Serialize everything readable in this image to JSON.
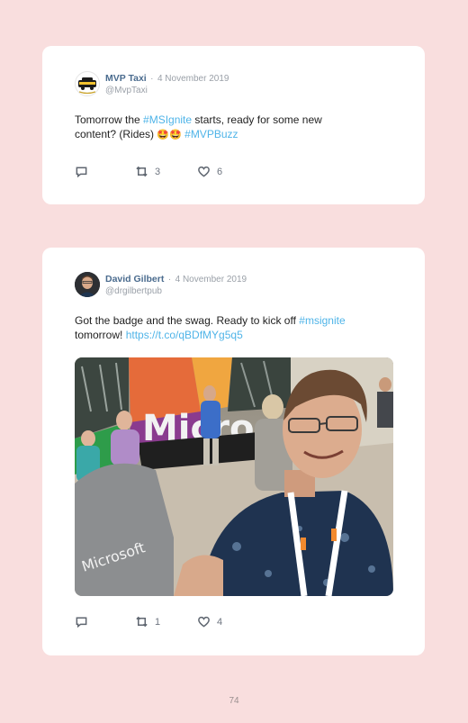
{
  "tweets": [
    {
      "author": "MVP Taxi",
      "separator": "·",
      "date": "4 November 2019",
      "handle": "@MvpTaxi",
      "avatar_icon": "taxi-logo-icon",
      "text_line1_a": "Tomorrow the ",
      "text_line1_link": "#MSIgnite",
      "text_line1_b": " starts, ready for some new",
      "text_line2_a": "content? (Rides) ",
      "text_emoji": "🤩🤩",
      "text_line2_link": "#MVPBuzz",
      "replies": "",
      "retweets": "3",
      "likes": "6"
    },
    {
      "author": "David Gilbert",
      "separator": "·",
      "date": "4 November 2019",
      "handle": "@drgilbertpub",
      "avatar_icon": "profile-photo",
      "text_line1_a": "Got the badge and the swag. Ready to kick off ",
      "text_line1_link": "#msignite",
      "text_line2_a": "tomorrow! ",
      "text_line2_link": "https://t.co/qBDfMYg5q5",
      "photo_sign_text": "Microsoft",
      "photo_bag_text": "Microsoft",
      "replies": "",
      "retweets": "1",
      "likes": "4"
    }
  ],
  "page_number": "74",
  "colors": {
    "background": "#f9dede",
    "card": "#ffffff",
    "link": "#4fb4e8",
    "name": "#4a6b8e",
    "muted": "#9aa0a8"
  },
  "icons": [
    "reply-icon",
    "retweet-icon",
    "like-icon"
  ]
}
